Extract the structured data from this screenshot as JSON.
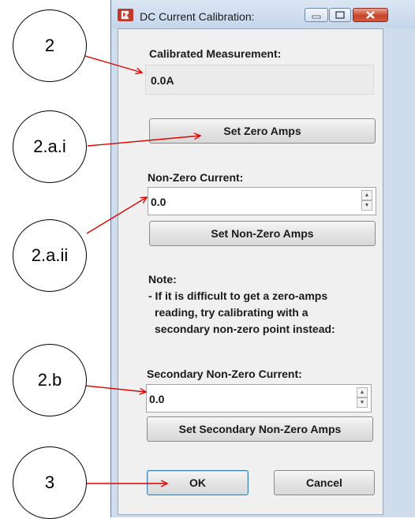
{
  "window": {
    "title": "DC Current Calibration:",
    "icon": "app-logo-icon",
    "controls": [
      "minimize-icon",
      "maximize-icon",
      "close-icon"
    ]
  },
  "calibrated": {
    "label": "Calibrated Measurement:",
    "value": "0.0A"
  },
  "zero": {
    "button": "Set Zero Amps"
  },
  "nonzero": {
    "label": "Non-Zero Current:",
    "value": "0.0",
    "button": "Set Non-Zero Amps"
  },
  "note": {
    "title": "Note:",
    "lines": [
      "- If it is difficult to get a zero-amps",
      "reading, try calibrating with a",
      "secondary non-zero point instead:"
    ]
  },
  "secondary": {
    "label": "Secondary Non-Zero Current:",
    "value": "0.0",
    "button": "Set Secondary Non-Zero Amps"
  },
  "footer": {
    "ok": "OK",
    "cancel": "Cancel"
  },
  "annotations": [
    "2",
    "2.a.i",
    "2.a.ii",
    "2.b",
    "3"
  ],
  "colors": {
    "arrow": "#e00000",
    "dialog_bg": "#f0f0f0",
    "frame": "#cfdcec"
  }
}
